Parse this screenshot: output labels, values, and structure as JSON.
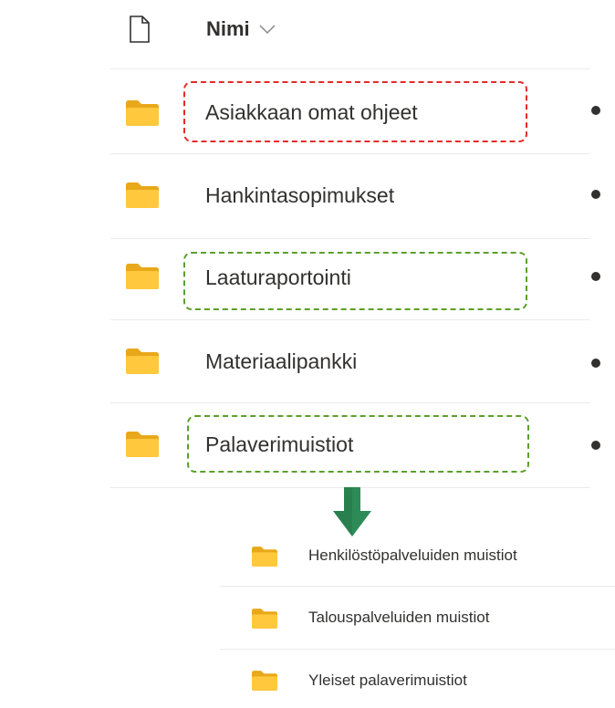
{
  "header": {
    "column_label": "Nimi",
    "file_icon": "document-icon",
    "sort_icon": "chevron-down-icon"
  },
  "folders": [
    {
      "name": "Asiakkaan omat ohjeet",
      "highlight": "red"
    },
    {
      "name": "Hankintasopimukset",
      "highlight": "none"
    },
    {
      "name": "Laaturaportointi",
      "highlight": "green"
    },
    {
      "name": "Materiaalipankki",
      "highlight": "none"
    },
    {
      "name": "Palaverimuistiot",
      "highlight": "green"
    }
  ],
  "subfolders": [
    {
      "name": "Henkilöstöpalveluiden muistiot"
    },
    {
      "name": "Talouspalveluiden muistiot"
    },
    {
      "name": "Yleiset palaverimuistiot"
    }
  ],
  "colors": {
    "highlight_red": "#e32b2b",
    "highlight_green": "#5aa02c",
    "arrow": "#2e8b57",
    "folder": "#ffc83d"
  }
}
